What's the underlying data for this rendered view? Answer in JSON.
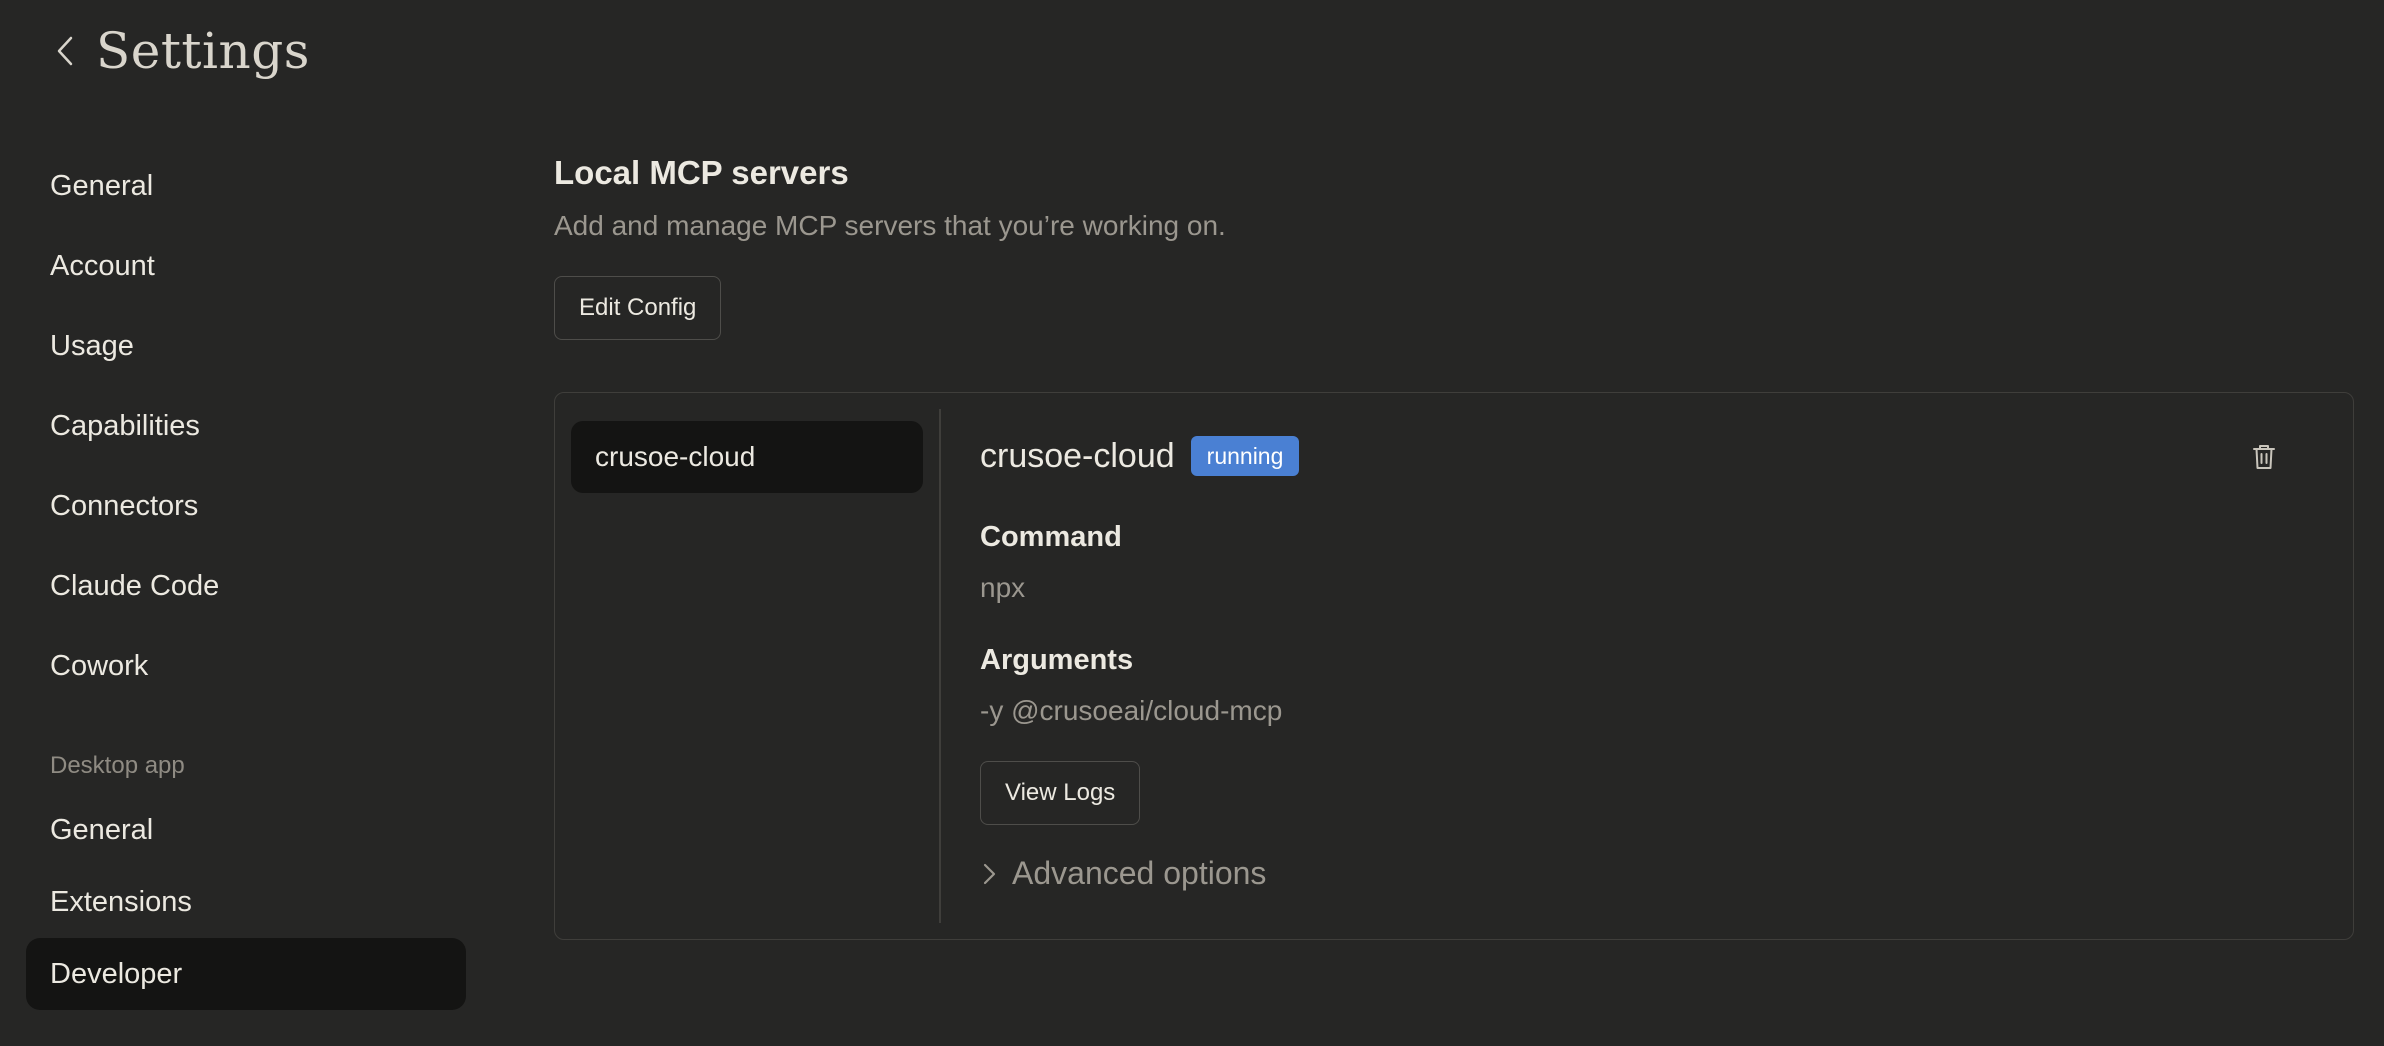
{
  "header": {
    "back_icon": "chevron-left-icon",
    "title": "Settings"
  },
  "sidebar": {
    "items": [
      {
        "label": "General"
      },
      {
        "label": "Account"
      },
      {
        "label": "Usage"
      },
      {
        "label": "Capabilities"
      },
      {
        "label": "Connectors"
      },
      {
        "label": "Claude Code"
      },
      {
        "label": "Cowork"
      }
    ],
    "desktop_section_label": "Desktop app",
    "desktop_items": [
      {
        "label": "General"
      },
      {
        "label": "Extensions"
      },
      {
        "label": "Developer",
        "active": true
      }
    ]
  },
  "main": {
    "title": "Local MCP servers",
    "description": "Add and manage MCP servers that you’re working on.",
    "edit_config_label": "Edit Config",
    "servers": [
      {
        "name": "crusoe-cloud",
        "selected": true
      }
    ],
    "detail": {
      "name": "crusoe-cloud",
      "status": "running",
      "delete_icon": "trash-icon",
      "command_label": "Command",
      "command_value": "npx",
      "arguments_label": "Arguments",
      "arguments_value": "-y @crusoeai/cloud-mcp",
      "view_logs_label": "View Logs",
      "advanced_icon": "chevron-right-icon",
      "advanced_label": "Advanced options"
    }
  },
  "colors": {
    "background": "#262625",
    "active_item": "#141413",
    "status_running": "#4a80d3",
    "text_primary": "#ece9e1",
    "text_muted": "#9b978f",
    "border": "#3f3e3b"
  }
}
